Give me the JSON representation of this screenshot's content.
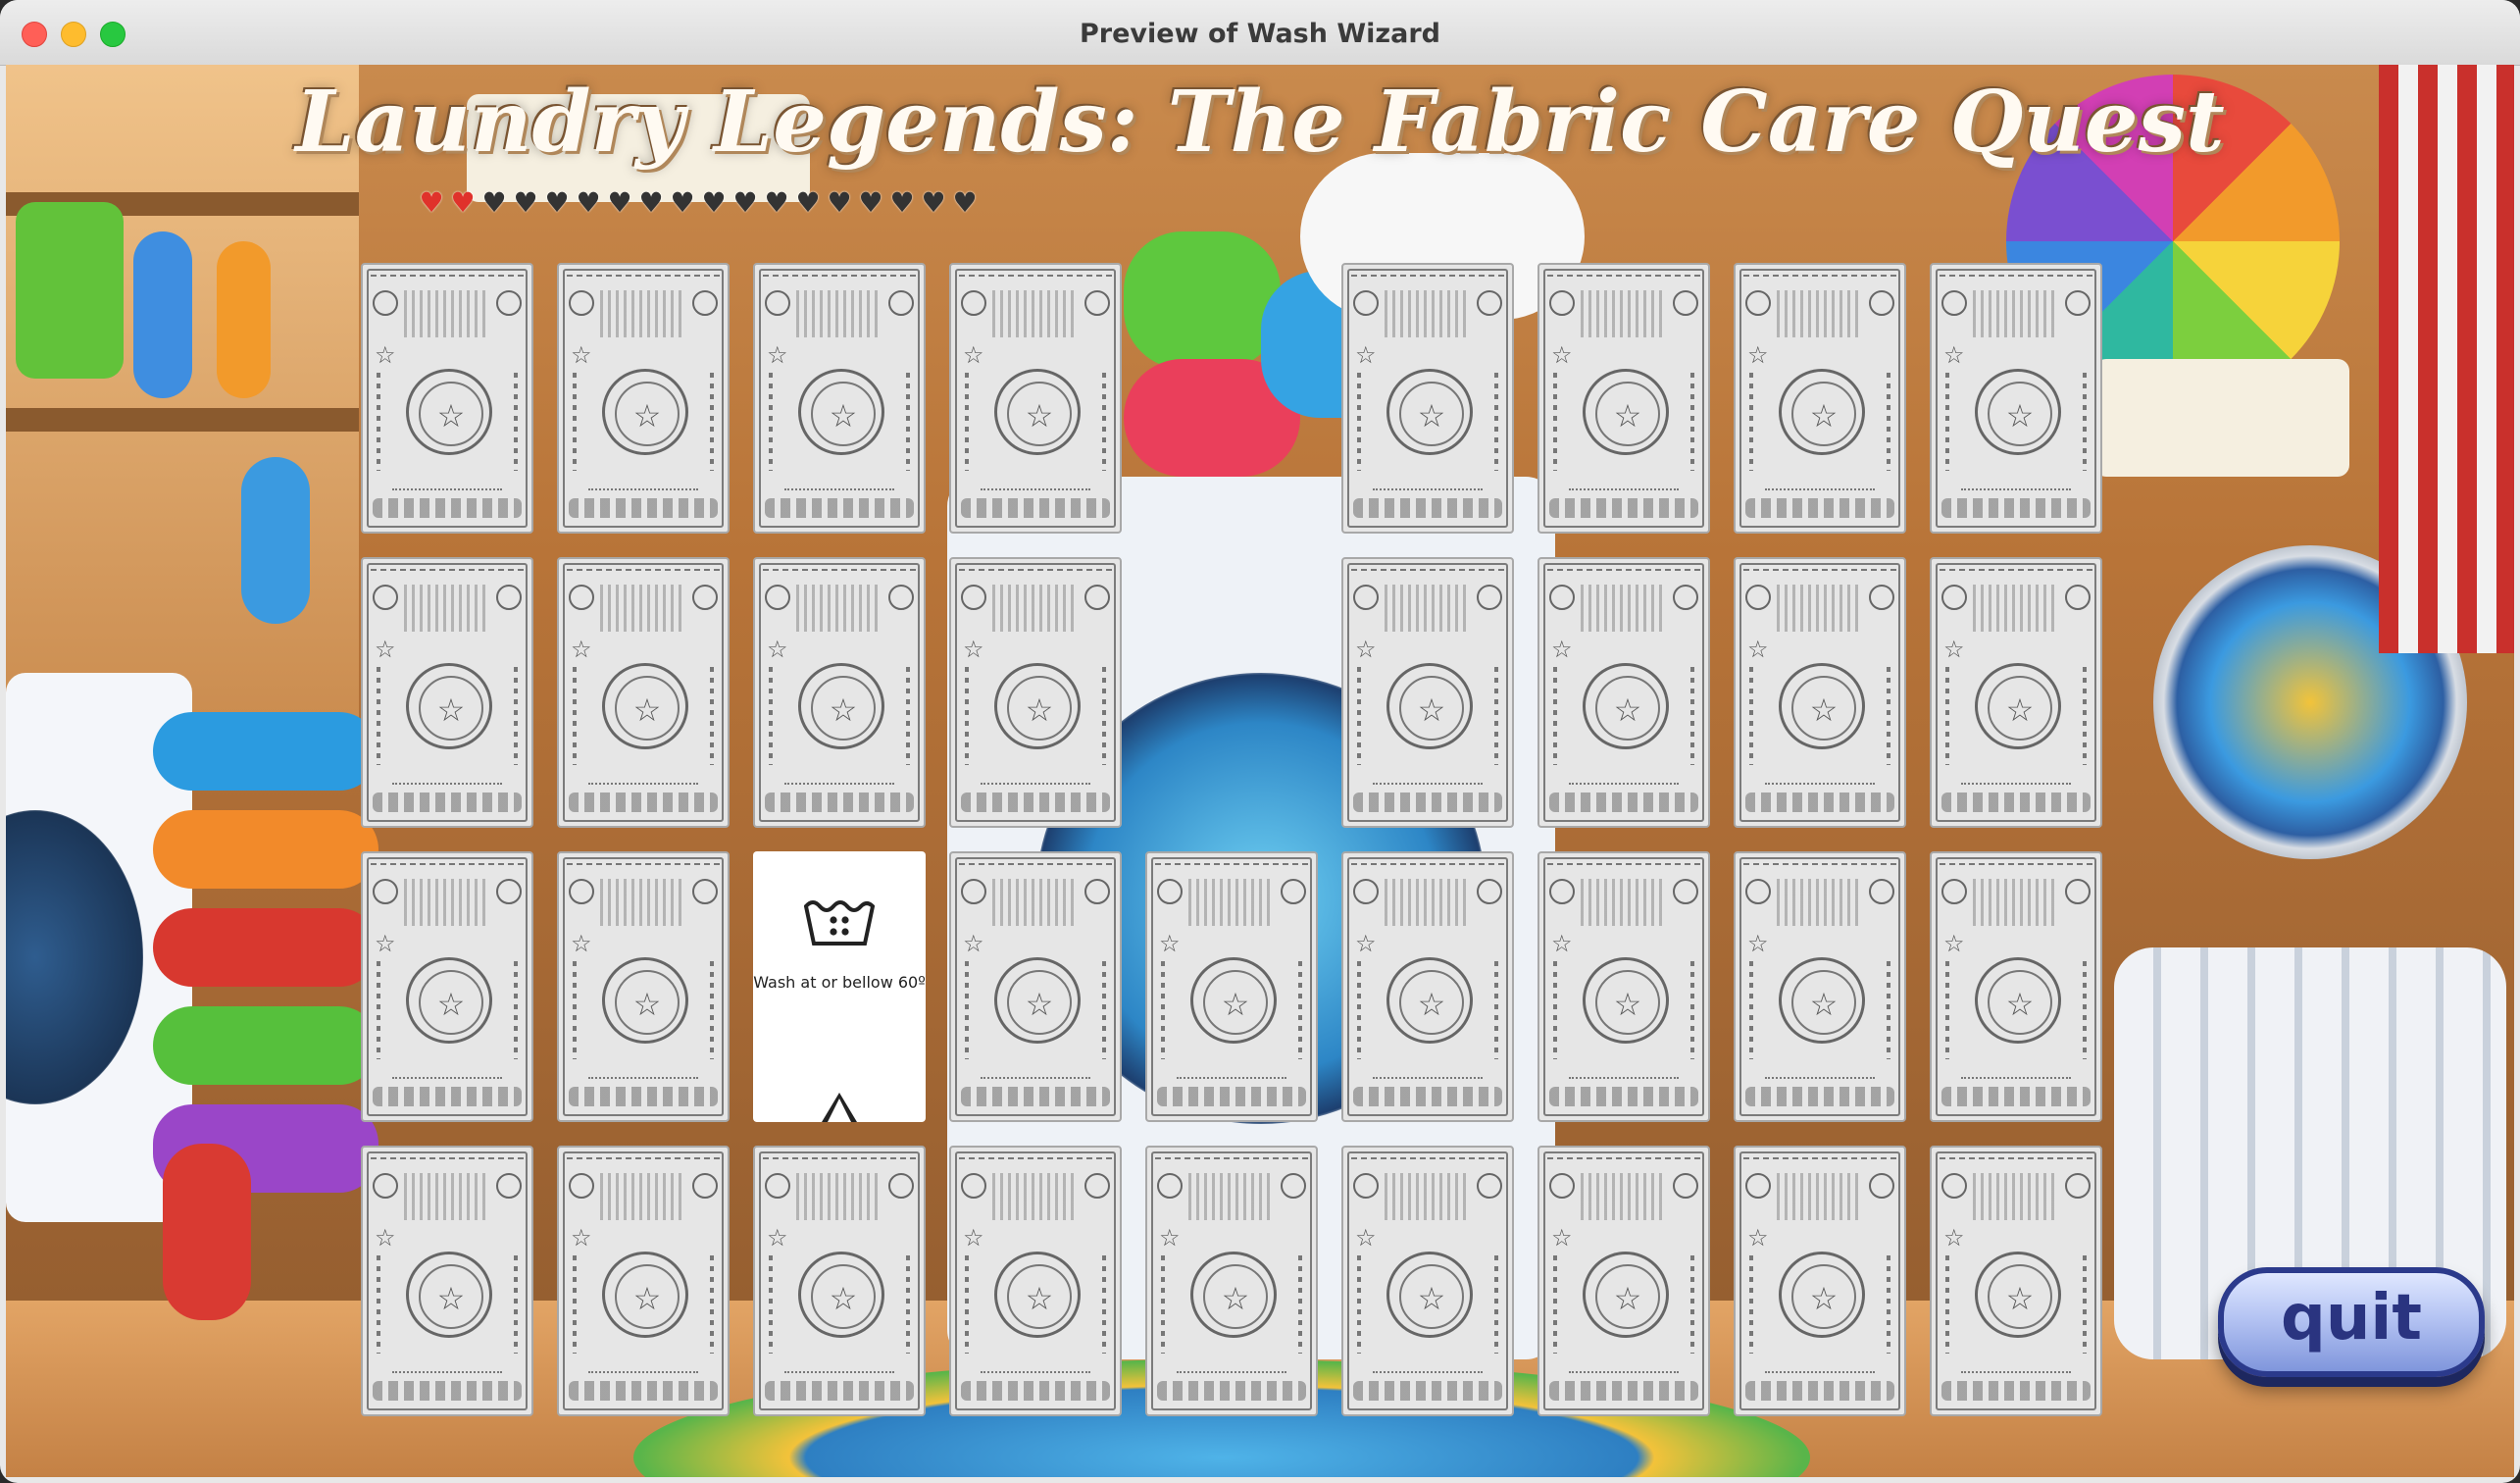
{
  "window": {
    "title": "Preview of Wash Wizard"
  },
  "game": {
    "title": "Laundry Legends: The Fabric Care Quest",
    "lives": {
      "full": 2,
      "total": 18
    },
    "columns": 9,
    "rows": 4,
    "gaps": [
      4,
      13
    ],
    "revealed": {
      "index": 20,
      "text": "Wash at or bellow 60º",
      "icon": "wash-60-tub-icon"
    },
    "quit_label": "quit"
  },
  "colors": {
    "heart_full": "#e0322b",
    "heart_empty": "#333333",
    "quit_button": "#b5c4f3",
    "quit_text": "#2a3480"
  }
}
